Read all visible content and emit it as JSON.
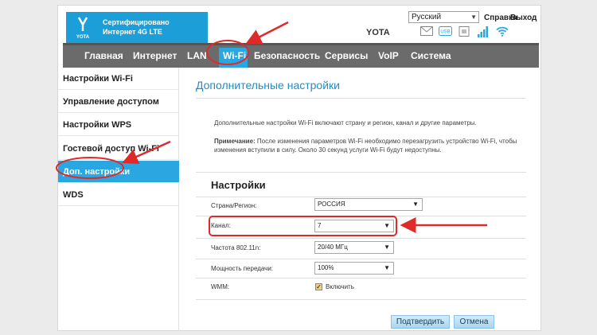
{
  "logo": {
    "text_line1": "Сертифицировано",
    "text_line2": "Интернет 4G LTE",
    "logo_label": "YOTA"
  },
  "header": {
    "language": "Русский",
    "help": "Справка",
    "logout": "Выход",
    "brand": "YOTA"
  },
  "nav": {
    "items": [
      "Главная",
      "Интернет",
      "LAN",
      "Wi-Fi",
      "Безопасность",
      "Сервисы",
      "VoIP",
      "Система"
    ],
    "active": "Wi-Fi"
  },
  "sidebar": {
    "items": [
      "Настройки Wi-Fi",
      "Управление доступом",
      "Настройки WPS",
      "Гостевой доступ Wi-Fi",
      "Доп. настройки",
      "WDS"
    ],
    "active": "Доп. настройки"
  },
  "content": {
    "title": "Дополнительные настройки",
    "desc1": "Дополнительные настройки Wi-Fi включают страну и регион, канал и другие параметры.",
    "note_label": "Примечание:",
    "note_text": " После изменения параметров Wi-Fi необходимо перезагрузить устройство Wi-Fi, чтобы",
    "note_text2": "изменения вступили в силу. Около 30 секунд услуги Wi-Fi будут недоступны.",
    "section": "Настройки",
    "rows": [
      {
        "label": "Страна/Регион:",
        "value": "РОССИЯ"
      },
      {
        "label": "Канал:",
        "value": "7"
      },
      {
        "label": "Частота 802.11n:",
        "value": "20/40 МГц"
      },
      {
        "label": "Мощность передачи:",
        "value": "100%"
      },
      {
        "label": "WMM:",
        "value": "Включить"
      }
    ],
    "wmm_checked": true,
    "confirm_button": "Подтвердить",
    "cancel_button": "Отмена"
  },
  "colors": {
    "accent": "#2aa7e0",
    "annotation": "#e02a2a",
    "nav_bg": "#6b6b6b"
  }
}
